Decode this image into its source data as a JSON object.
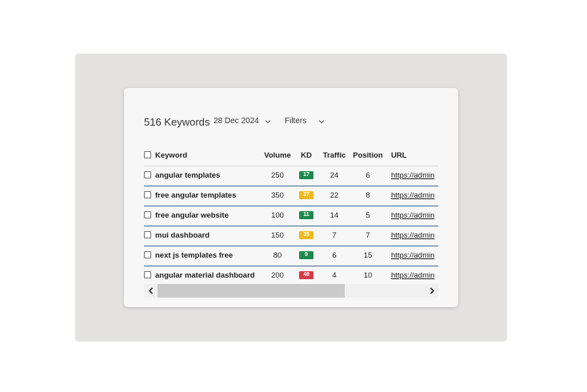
{
  "header": {
    "title": "516 Keywords",
    "date_label": "28 Dec 2024",
    "filters_label": "Filters"
  },
  "table": {
    "columns": {
      "keyword": "Keyword",
      "volume": "Volume",
      "kd": "KD",
      "traffic": "Traffic",
      "position": "Position",
      "url": "URL"
    },
    "rows": [
      {
        "keyword": "angular templates",
        "volume": "250",
        "kd": "17",
        "kd_color": "#1e8a4c",
        "traffic": "24",
        "position": "6",
        "url": "https://admin"
      },
      {
        "keyword": "free angular templates",
        "volume": "350",
        "kd": "27",
        "kd_color": "#f2b81c",
        "traffic": "22",
        "position": "8",
        "url": "https://admin"
      },
      {
        "keyword": "free angular website",
        "volume": "100",
        "kd": "11",
        "kd_color": "#1e8a4c",
        "traffic": "14",
        "position": "5",
        "url": "https://admin"
      },
      {
        "keyword": "mui dashboard",
        "volume": "150",
        "kd": "35",
        "kd_color": "#f2b81c",
        "traffic": "7",
        "position": "7",
        "url": "https://admin"
      },
      {
        "keyword": "next js templates free",
        "volume": "80",
        "kd": "9",
        "kd_color": "#1e8a4c",
        "traffic": "6",
        "position": "15",
        "url": "https://admin"
      },
      {
        "keyword": "angular material dashboard",
        "volume": "200",
        "kd": "48",
        "kd_color": "#d93845",
        "traffic": "4",
        "position": "10",
        "url": "https://admin"
      }
    ]
  },
  "scrollbar": {
    "position_fraction": 0.0,
    "visible_fraction": 0.7
  },
  "icons": {
    "date_chevron": "chevron-down-icon",
    "filters_chevron": "chevron-down-icon",
    "scroll_left": "chevron-left-icon",
    "scroll_right": "chevron-right-icon"
  }
}
